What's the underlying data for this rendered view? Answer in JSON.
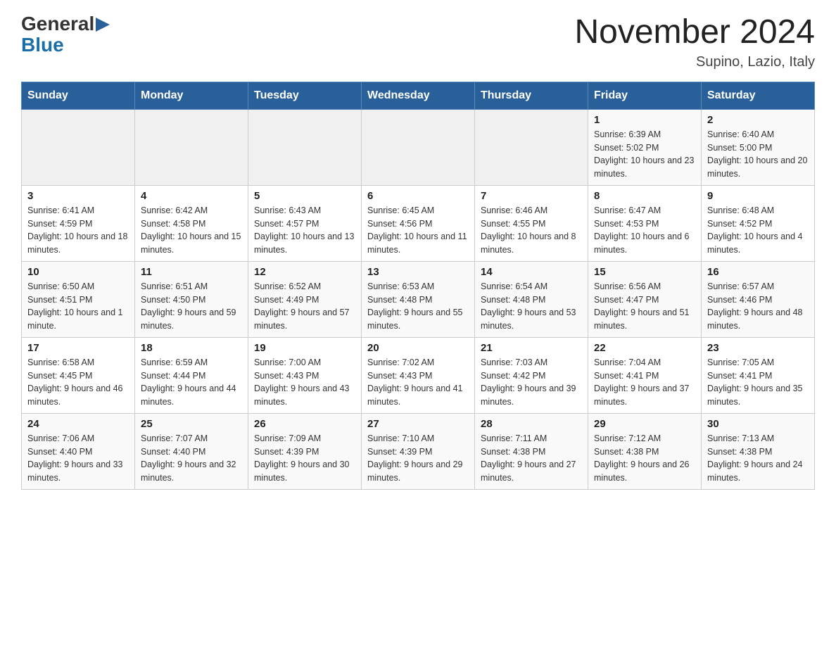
{
  "header": {
    "logo_general": "General",
    "logo_blue": "Blue",
    "month_title": "November 2024",
    "location": "Supino, Lazio, Italy"
  },
  "days_of_week": [
    "Sunday",
    "Monday",
    "Tuesday",
    "Wednesday",
    "Thursday",
    "Friday",
    "Saturday"
  ],
  "weeks": [
    [
      {
        "day": "",
        "info": ""
      },
      {
        "day": "",
        "info": ""
      },
      {
        "day": "",
        "info": ""
      },
      {
        "day": "",
        "info": ""
      },
      {
        "day": "",
        "info": ""
      },
      {
        "day": "1",
        "info": "Sunrise: 6:39 AM\nSunset: 5:02 PM\nDaylight: 10 hours and 23 minutes."
      },
      {
        "day": "2",
        "info": "Sunrise: 6:40 AM\nSunset: 5:00 PM\nDaylight: 10 hours and 20 minutes."
      }
    ],
    [
      {
        "day": "3",
        "info": "Sunrise: 6:41 AM\nSunset: 4:59 PM\nDaylight: 10 hours and 18 minutes."
      },
      {
        "day": "4",
        "info": "Sunrise: 6:42 AM\nSunset: 4:58 PM\nDaylight: 10 hours and 15 minutes."
      },
      {
        "day": "5",
        "info": "Sunrise: 6:43 AM\nSunset: 4:57 PM\nDaylight: 10 hours and 13 minutes."
      },
      {
        "day": "6",
        "info": "Sunrise: 6:45 AM\nSunset: 4:56 PM\nDaylight: 10 hours and 11 minutes."
      },
      {
        "day": "7",
        "info": "Sunrise: 6:46 AM\nSunset: 4:55 PM\nDaylight: 10 hours and 8 minutes."
      },
      {
        "day": "8",
        "info": "Sunrise: 6:47 AM\nSunset: 4:53 PM\nDaylight: 10 hours and 6 minutes."
      },
      {
        "day": "9",
        "info": "Sunrise: 6:48 AM\nSunset: 4:52 PM\nDaylight: 10 hours and 4 minutes."
      }
    ],
    [
      {
        "day": "10",
        "info": "Sunrise: 6:50 AM\nSunset: 4:51 PM\nDaylight: 10 hours and 1 minute."
      },
      {
        "day": "11",
        "info": "Sunrise: 6:51 AM\nSunset: 4:50 PM\nDaylight: 9 hours and 59 minutes."
      },
      {
        "day": "12",
        "info": "Sunrise: 6:52 AM\nSunset: 4:49 PM\nDaylight: 9 hours and 57 minutes."
      },
      {
        "day": "13",
        "info": "Sunrise: 6:53 AM\nSunset: 4:48 PM\nDaylight: 9 hours and 55 minutes."
      },
      {
        "day": "14",
        "info": "Sunrise: 6:54 AM\nSunset: 4:48 PM\nDaylight: 9 hours and 53 minutes."
      },
      {
        "day": "15",
        "info": "Sunrise: 6:56 AM\nSunset: 4:47 PM\nDaylight: 9 hours and 51 minutes."
      },
      {
        "day": "16",
        "info": "Sunrise: 6:57 AM\nSunset: 4:46 PM\nDaylight: 9 hours and 48 minutes."
      }
    ],
    [
      {
        "day": "17",
        "info": "Sunrise: 6:58 AM\nSunset: 4:45 PM\nDaylight: 9 hours and 46 minutes."
      },
      {
        "day": "18",
        "info": "Sunrise: 6:59 AM\nSunset: 4:44 PM\nDaylight: 9 hours and 44 minutes."
      },
      {
        "day": "19",
        "info": "Sunrise: 7:00 AM\nSunset: 4:43 PM\nDaylight: 9 hours and 43 minutes."
      },
      {
        "day": "20",
        "info": "Sunrise: 7:02 AM\nSunset: 4:43 PM\nDaylight: 9 hours and 41 minutes."
      },
      {
        "day": "21",
        "info": "Sunrise: 7:03 AM\nSunset: 4:42 PM\nDaylight: 9 hours and 39 minutes."
      },
      {
        "day": "22",
        "info": "Sunrise: 7:04 AM\nSunset: 4:41 PM\nDaylight: 9 hours and 37 minutes."
      },
      {
        "day": "23",
        "info": "Sunrise: 7:05 AM\nSunset: 4:41 PM\nDaylight: 9 hours and 35 minutes."
      }
    ],
    [
      {
        "day": "24",
        "info": "Sunrise: 7:06 AM\nSunset: 4:40 PM\nDaylight: 9 hours and 33 minutes."
      },
      {
        "day": "25",
        "info": "Sunrise: 7:07 AM\nSunset: 4:40 PM\nDaylight: 9 hours and 32 minutes."
      },
      {
        "day": "26",
        "info": "Sunrise: 7:09 AM\nSunset: 4:39 PM\nDaylight: 9 hours and 30 minutes."
      },
      {
        "day": "27",
        "info": "Sunrise: 7:10 AM\nSunset: 4:39 PM\nDaylight: 9 hours and 29 minutes."
      },
      {
        "day": "28",
        "info": "Sunrise: 7:11 AM\nSunset: 4:38 PM\nDaylight: 9 hours and 27 minutes."
      },
      {
        "day": "29",
        "info": "Sunrise: 7:12 AM\nSunset: 4:38 PM\nDaylight: 9 hours and 26 minutes."
      },
      {
        "day": "30",
        "info": "Sunrise: 7:13 AM\nSunset: 4:38 PM\nDaylight: 9 hours and 24 minutes."
      }
    ]
  ]
}
